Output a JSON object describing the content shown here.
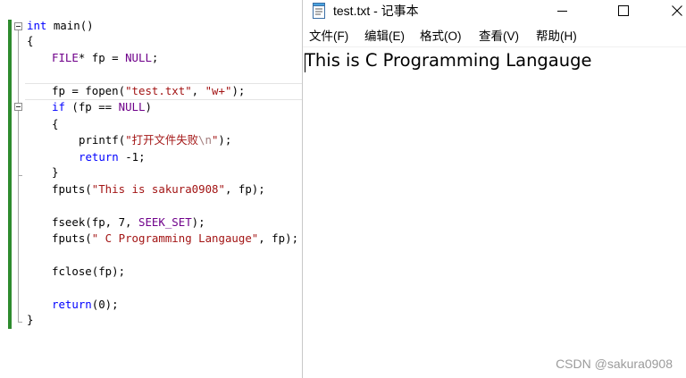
{
  "editor": {
    "lines": {
      "main_sig": [
        "int",
        " main()"
      ],
      "open_brace": "{",
      "decl": [
        "FILE",
        "* fp = ",
        "NULL",
        ";"
      ],
      "fopen": [
        "fp = fopen(",
        "\"test.txt\"",
        ", ",
        "\"w+\"",
        ");"
      ],
      "if_line": [
        "if",
        " (fp == ",
        "NULL",
        ")"
      ],
      "if_open": "{",
      "printf": [
        "printf(",
        "\"打开文件失败",
        "\\n",
        "\"",
        ");"
      ],
      "ret1": [
        "return",
        " -1;"
      ],
      "if_close": "}",
      "fputs1": [
        "fputs(",
        "\"This is sakura0908\"",
        ", fp);"
      ],
      "fseek": [
        "fseek(fp, 7, ",
        "SEEK_SET",
        ");"
      ],
      "fputs2": [
        "fputs(",
        "\" C Programming Langauge\"",
        ", fp);"
      ],
      "fclose": "fclose(fp);",
      "ret0": [
        "return",
        "(0);"
      ],
      "close_brace": "}"
    }
  },
  "notepad": {
    "title": "test.txt - 记事本",
    "menu": [
      "文件(F)",
      "编辑(E)",
      "格式(O)",
      "查看(V)",
      "帮助(H)"
    ],
    "content": "This is C Programming Langauge"
  },
  "watermark": "CSDN @sakura0908"
}
